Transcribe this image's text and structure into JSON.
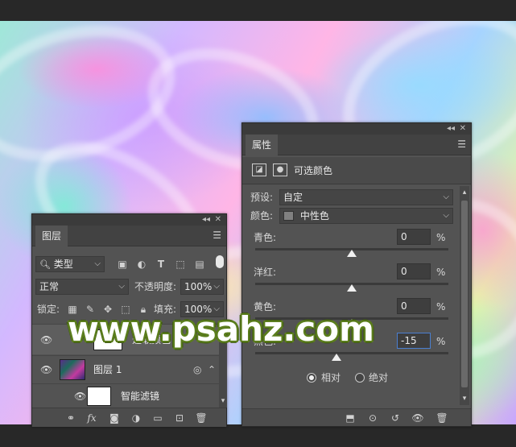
{
  "layers_panel": {
    "tab": "图层",
    "filter_type": "类型",
    "blend_mode": "正常",
    "opacity_label": "不透明度:",
    "opacity_value": "100%",
    "lock_label": "锁定:",
    "fill_label": "填充:",
    "fill_value": "100%",
    "layers": [
      {
        "name": "选取颜色 1"
      },
      {
        "name": "图层 1"
      },
      {
        "name": "智能滤镜"
      }
    ],
    "footer_icons": [
      "link-icon",
      "fx-icon",
      "mask-icon",
      "adjustment-icon",
      "folder-icon",
      "new-layer-icon",
      "trash-icon"
    ],
    "fx_label": "fx"
  },
  "properties_panel": {
    "tab": "属性",
    "title": "可选颜色",
    "preset_label": "预设:",
    "preset_value": "自定",
    "colors_label": "颜色:",
    "colors_value": "中性色",
    "sliders": [
      {
        "label": "青色:",
        "value": "0",
        "unit": "%",
        "position": 0.5
      },
      {
        "label": "洋红:",
        "value": "0",
        "unit": "%",
        "position": 0.5
      },
      {
        "label": "黄色:",
        "value": "0",
        "unit": "%",
        "position": 0.5
      },
      {
        "label": "黑色:",
        "value": "-15",
        "unit": "%",
        "position": 0.42
      }
    ],
    "method_relative": "相对",
    "method_absolute": "绝对",
    "method_selected": "relative"
  },
  "watermark": "www.psahz.com"
}
